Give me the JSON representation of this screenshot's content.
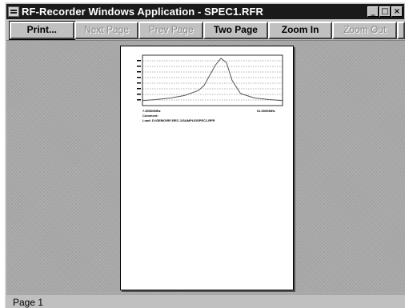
{
  "window": {
    "title": "RF-Recorder Windows Application - SPEC1.RFR",
    "controls": {
      "minimize": "_",
      "maximize": "□",
      "close": "×"
    }
  },
  "toolbar": {
    "buttons": [
      {
        "label": "Print...",
        "enabled": true
      },
      {
        "label": "Next Page",
        "enabled": false
      },
      {
        "label": "Prev Page",
        "enabled": false
      },
      {
        "label": "Two Page",
        "enabled": true
      },
      {
        "label": "Zoom In",
        "enabled": true
      },
      {
        "label": "Zoom Out",
        "enabled": false
      }
    ]
  },
  "preview_page": {
    "start_label": "7.50000MHz",
    "stop_label": "61.0000MHz",
    "comment_label": "Comment:",
    "file_label": "Load: D:\\DEMO\\RF-REC-1\\SAMPLE\\SPEC1.RFR"
  },
  "chart_data": {
    "type": "line",
    "x": [
      0,
      0.1,
      0.2,
      0.3,
      0.4,
      0.44,
      0.48,
      0.52,
      0.56,
      0.6,
      0.64,
      0.7,
      0.8,
      0.9,
      1.0
    ],
    "values": [
      1.0,
      1.2,
      1.5,
      2.0,
      3.0,
      4.0,
      6.0,
      8.0,
      9.4,
      8.5,
      5.0,
      2.4,
      1.5,
      1.2,
      1.0
    ],
    "ylim": [
      0,
      10
    ],
    "xlim": [
      0,
      1
    ],
    "grid": true
  },
  "status": {
    "page": "Page 1"
  }
}
